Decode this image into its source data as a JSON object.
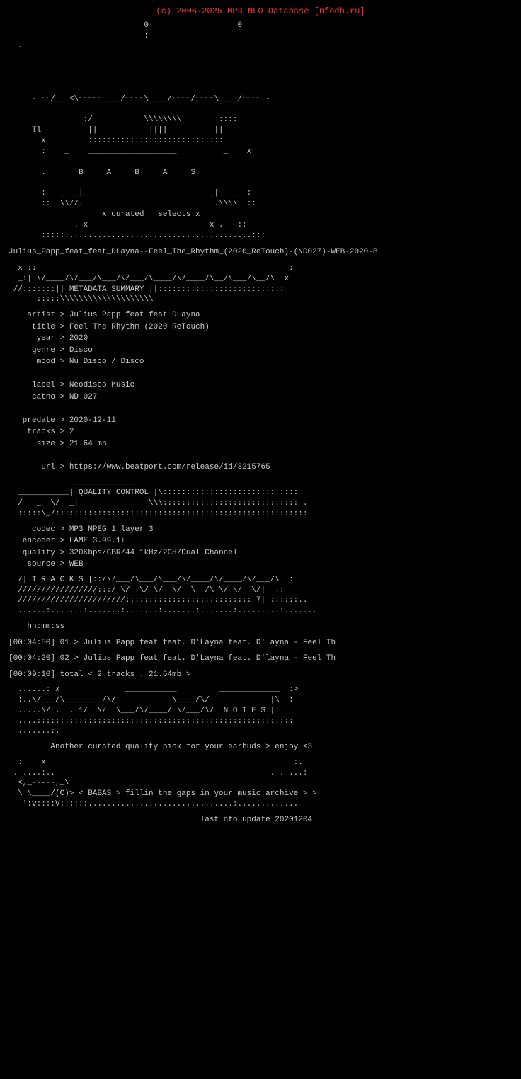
{
  "header": {
    "copyright": "(c) 2006-2025 MP3 NFO Database [nfodb.ru]"
  },
  "ascii_logo": "                             0                   0\n                             :\n  .\n\n\n\n\n     - ~~/___<\\~~~~~____/~~~~\\____/~~~~/~~~~\\____/~~~~ -\n\n                :/           \\\\\\\\\\\\          ::::\n     Tl          ||           ||||          ||\n       x         :::::::::::::::::::::::::::::\n       :    _    ___________________          _    x\n\n       .       B     A     B     A     S\n\n       :   _  _|_                          _|_  _  :\n       ::  \\\\//.                            .\\\\\\  ::\n                    x curated   selects x\n              . x                          x .   ::\n       ::::::.......................................:::",
  "release_title": "Julius_Papp_feat_feat_DLayna--Feel_The_Rhythm_(2020_ReTouch)-(ND027)-WEB-2020-B",
  "metadata_banner": "  x ::                                                      :\n  _:| \\/____/\\/___/\\___/\\/___/\\____/\\/____/\\__/\\___/\\__/\\  x\n  //:::::::|| METADATA SUMMARY ||:::::::::::::::::::::::::::\n      :::::\\\\\\\\\\\\\\\\\\\\\\\\\\\\",
  "metadata": {
    "artist": "Julius Papp feat feat DLayna",
    "title": "Feel The Rhythm (2020 ReTouch)",
    "year": "2020",
    "genre": "Disco",
    "mood": "Nu Disco / Disco",
    "label": "Neodisco Music",
    "catno": "ND 027",
    "predate": "2020-12-11",
    "tracks": "2",
    "size": "21.64 mb",
    "url": "https://www.beatport.com/release/id/3215765"
  },
  "quality_banner": "              _____________\n  ___________| QUALITY CONTROL |\\:::::::::::::::::::::::::::::\n  /   _  \\/  _|               \\\\\\::::::::::::::::::::::::::::: .\n  :::::\\_/::::::::::::::::::::::::::::::::::::::::::::::::::::::",
  "quality": {
    "codec": "MP3 MPEG 1 layer 3",
    "encoder": "LAME 3.99.1+",
    "quality": "320Kbps/CBR/44.1kHz/2CH/Dual Channel",
    "source": "WEB"
  },
  "tracks_banner": "  /| T R A C K S |::/\\/___/\\___/\\___/\\/____/\\/____/\\/___/\\  :\n  /////////////////:::/ \\/  \\/ \\/  \\/  \\  /\\ \\/ \\/  \\/|  ::\n  ///////////////////////::::::::::::::::::::::::::: 7| ::::::.\n  ......:.......:.......:.......:.......:.......:.........:.......",
  "tracks": {
    "header": "hh:mm:ss",
    "list": [
      "[00:04:50] 01 > Julius Papp feat feat. D'Layna feat. D'layna - Feel Th",
      "[00:04:20] 02 > Julius Papp feat feat. D'Layna feat. D'layna - Feel Th"
    ],
    "total": "[00:09:10] total < 2 tracks . 21.64mb >"
  },
  "notes_banner": "  ......: x              ___________         _____________  :>\n  :..\\/___/\\________/\\/            \\____/\\/             |\\  :\n  .....\\/  \\.  1/  \\/  \\___/\\/____/ \\/___/\\/  N O T E S |:\n  ....:::::::::::::::::::::::::::::::::::::::::::::::::::::::\n  .......:.",
  "notes": {
    "text": "Another curated quality pick for your earbuds > enjoy <3"
  },
  "footer_banner": "  :    x                                                     :.\n . ....:..                                              . . ...:\n  <,_-----,_\\\n  \\ \\____/(C)> < BABAS > fillin the gaps in your music archive > >\n   ':v::::V::::::...............................:.............",
  "footer": {
    "last_update": "last nfo update 20201204"
  }
}
